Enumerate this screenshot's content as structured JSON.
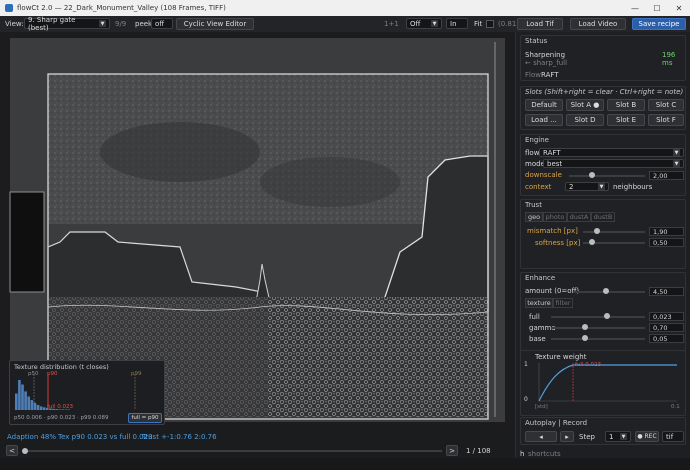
{
  "window": {
    "title": "flowCt 2.0 — 22_Dark_Monument_Valley  (108 Frames, TIFF)",
    "minimize": "—",
    "maximize": "☐",
    "close": "✕"
  },
  "toolbar": {
    "view_label": "View:",
    "view_value": "9. Sharp gate (best)",
    "frame_count": "9/9",
    "peek_label": "peek",
    "peek_value": "off",
    "cyclic_button": "Cyclic View Editor",
    "step_label": "1+1",
    "off_value": "Off",
    "in_value": "In",
    "fit_label": "Fit",
    "zoom": "(0.81x)",
    "load_tif": "Load Tif",
    "load_video": "Load Video",
    "save_recipe": "Save recipe"
  },
  "texture_popup": {
    "title": "Texture distribution  (t closes)",
    "p50_tag": "p50",
    "p90_tag": "p90",
    "p99_tag": "p99",
    "full_tag": "full 0.023",
    "stats": "p50 0.006 · p90 0.023 · p99 0.089",
    "full_button": "full = p90",
    "bars": [
      0.55,
      1.0,
      0.85,
      0.62,
      0.45,
      0.33,
      0.24,
      0.17,
      0.12,
      0.09,
      0.07,
      0.05,
      0.04,
      0.03,
      0.02,
      0.02,
      0.015,
      0.01
    ]
  },
  "statusline": {
    "adaption": "Adaption 48%",
    "tex": "Tex p90 0.023 vs full 0.023",
    "trust": "Trust +-1:0.76  2:0.76"
  },
  "scrubber": {
    "prev": "<",
    "next": ">",
    "position": "1 / 108",
    "fraction": 0.0
  },
  "status": {
    "header": "Status",
    "stage": "Sharpening",
    "time": "196 ms",
    "sub": "← sharp_full",
    "flow_label": "Flow",
    "flow_value": "RAFT"
  },
  "slots": {
    "header": "Slots  (Shift+right = clear · Ctrl+right = note)",
    "buttons": [
      "Default",
      "Slot A ●",
      "Slot B",
      "Slot C",
      "Load ...",
      "Slot D",
      "Slot E",
      "Slot F"
    ]
  },
  "engine": {
    "header": "Engine",
    "flow_label": "flow",
    "flow_value": "RAFT",
    "mode_label": "mode",
    "mode_value": "best",
    "downscale_label": "downscale",
    "downscale_value": "2,00",
    "downscale_fraction": 0.28,
    "context_label": "context",
    "context_value": "2",
    "context_suffix": "neighbours"
  },
  "trust": {
    "header": "Trust",
    "tabs": [
      "geo",
      "photo",
      "dustA",
      "dustB"
    ],
    "mismatch_label": "mismatch [px]",
    "mismatch_value": "1,90",
    "mismatch_fraction": 0.2,
    "softness_label": "softness [px]",
    "softness_value": "0,50",
    "softness_fraction": 0.1
  },
  "enhance": {
    "header": "Enhance",
    "amount_label": "amount (0=off)",
    "amount_value": "4,50",
    "amount_fraction": 0.45,
    "tabs": [
      "texture",
      "filter"
    ],
    "full_label": "full",
    "full_value": "0,023",
    "full_fraction": 0.6,
    "gamma_label": "gamma",
    "gamma_value": "0,70",
    "gamma_fraction": 0.35,
    "base_label": "base",
    "base_value": "0,05",
    "base_fraction": 0.35
  },
  "texture_weight": {
    "title": "Texture weight",
    "y_top": "1",
    "y_bottom": "0",
    "x_left": "[std]",
    "x_right": "0.1",
    "marker": "full 0.023"
  },
  "autoplay": {
    "header": "Autoplay | Record",
    "prev": "◂",
    "next": "▸",
    "step_label": "Step",
    "step_value": "1",
    "rec": "● REC",
    "format": "tif"
  },
  "shortcuts": {
    "key": "h",
    "label": "shortcuts"
  },
  "colors": {
    "accent": "#2d5ea8",
    "p90_line": "#d23b3b",
    "amber": "#d9a34a",
    "status_text": "#4f9fe0",
    "ms_green": "#6fd06f"
  }
}
